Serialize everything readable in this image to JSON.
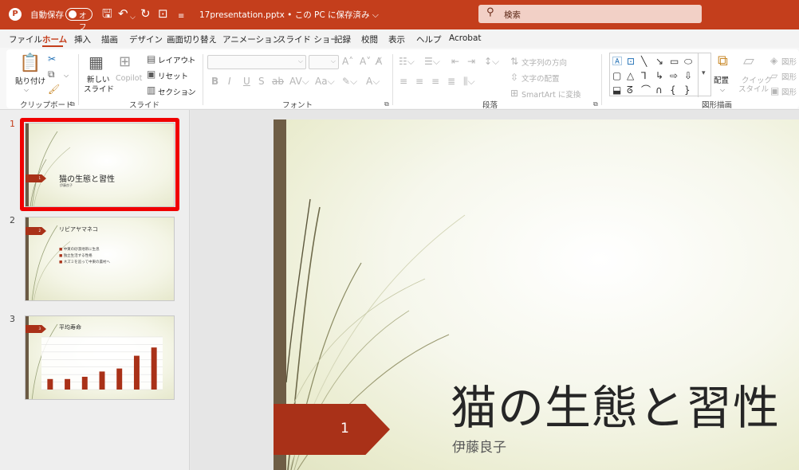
{
  "titlebar": {
    "app_logo": "powerpoint-logo",
    "autosave_label": "自動保存",
    "autosave_state": "オフ",
    "doc_title": "17presentation.pptx • この PC に保存済み ⌵",
    "search_placeholder": "検索"
  },
  "tabs": [
    "ファイル",
    "ホーム",
    "挿入",
    "描画",
    "デザイン",
    "画面切り替え",
    "アニメーション",
    "スライド ショー",
    "記録",
    "校閲",
    "表示",
    "ヘルプ",
    "Acrobat"
  ],
  "active_tab": "ホーム",
  "ribbon": {
    "clipboard": {
      "paste": "貼り付け",
      "group": "クリップボード"
    },
    "slides": {
      "new_slide_line1": "新しい",
      "new_slide_line2": "スライド",
      "copilot": "Copilot",
      "layout": "レイアウト",
      "reset": "リセット",
      "section": "セクション",
      "group": "スライド"
    },
    "font": {
      "group": "フォント"
    },
    "paragraph": {
      "text_direction": "文字列の方向",
      "align_text": "文字の配置",
      "smartart": "SmartArt に変換",
      "group": "段落"
    },
    "drawing": {
      "arrange": "配置",
      "quick_styles_line1": "クイック",
      "quick_styles_line2": "スタイル",
      "shape_fill": "図形",
      "shape_outline": "図形",
      "shape_effects": "図形",
      "group": "図形描画"
    }
  },
  "slides_pane": {
    "items": [
      {
        "number": "1",
        "title": "猫の生態と習性",
        "subtitle": "伊藤良子",
        "tag": "1"
      },
      {
        "number": "2",
        "title": "リビアヤマネコ",
        "tag": "2",
        "bullets": [
          "中東の砂漠地帯に生息",
          "独立生活する性格",
          "ネズミを追って中東の農村へ"
        ]
      },
      {
        "number": "3",
        "title": "平均寿命",
        "tag": "3"
      }
    ]
  },
  "chart_data": {
    "type": "bar",
    "categories": [
      "",
      "",
      "",
      "",
      "",
      "",
      ""
    ],
    "values": [
      14,
      14,
      17,
      24,
      28,
      45,
      56
    ],
    "ylim": [
      0,
      70
    ],
    "color": "#a93118"
  },
  "slide": {
    "number": "1",
    "title": "猫の生態と習性",
    "subtitle": "伊藤良子"
  },
  "colors": {
    "accent": "#c43e1c",
    "tag": "#a93118",
    "selection": "#f00000"
  }
}
